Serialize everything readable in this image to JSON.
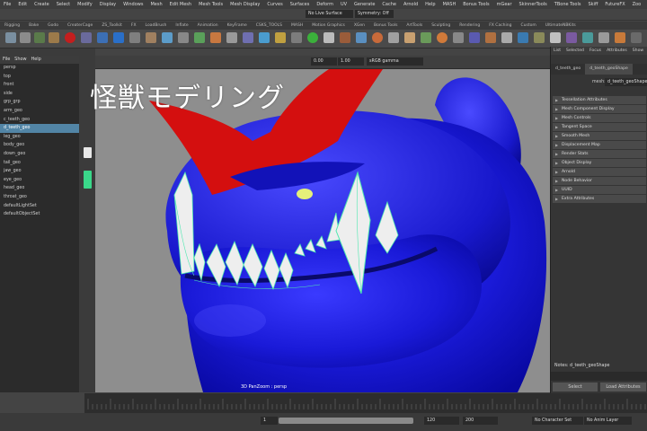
{
  "menubar": [
    "File",
    "Edit",
    "Create",
    "Select",
    "Modify",
    "Display",
    "Windows",
    "Mesh",
    "Edit Mesh",
    "Mesh Tools",
    "Mesh Display",
    "Curves",
    "Surfaces",
    "Deform",
    "UV",
    "Generate",
    "Cache",
    "Arnold",
    "Help",
    "MASH",
    "Bonus Tools",
    "mGear",
    "SkinnerTools",
    "TBone Tools",
    "Skiff",
    "FutureFX",
    "Zoo",
    "Tools",
    "Java Transfer",
    "Y-Fay",
    "Aimodel"
  ],
  "statusline": {
    "no_live_surface": "No Live Surface",
    "symmetry": "Symmetry: Off"
  },
  "shelf_tabs": [
    "Rigging",
    "Bake",
    "Godo",
    "CreaterCage",
    "ZS_Toolkit",
    "FX",
    "LoadBrush",
    "Inflate",
    "Animation",
    "KeyFrame",
    "CSKS_TOOLS",
    "MASH",
    "Motion Graphics",
    "XGen",
    "Bonus Tools",
    "ArtTools",
    "Sculpting",
    "Rendering",
    "FX Caching",
    "Custom",
    "UltimateNBKits"
  ],
  "outliner": {
    "header": [
      "File",
      "Show",
      "Help"
    ],
    "items": [
      "persp",
      "top",
      "front",
      "side",
      "grp_grp",
      "arm_geo",
      "c_teeth_geo",
      "d_teeth_geo",
      "leg_geo",
      "body_geo",
      "down_geo",
      "tail_geo",
      "jaw_geo",
      "eye_geo",
      "head_geo",
      "throat_geo",
      "defaultLightSet",
      "defaultObjectSet"
    ],
    "selected_index": 7
  },
  "viewport": {
    "title_overlay": "怪獣モデリング",
    "camera_label": "3D PanZoom : persp",
    "field_value": "0.00",
    "field2_value": "1.00",
    "colorspace": "sRGB gamma"
  },
  "attribute_editor": {
    "tabs": [
      "List",
      "Selected",
      "Focus",
      "Attributes",
      "Show",
      "Help"
    ],
    "node_tabs": [
      "d_teeth_geo",
      "d_teeth_geoShape"
    ],
    "mesh_label": "mesh:",
    "mesh_value": "d_teeth_geoShape",
    "sections": [
      "Tessellation Attributes",
      "Mesh Component Display",
      "Mesh Controls",
      "Tangent Space",
      "Smooth Mesh",
      "Displacement Map",
      "Render Stats",
      "Object Display",
      "Arnold",
      "Node Behavior",
      "UUID",
      "Extra Attributes"
    ],
    "notes_label": "Notes:  d_teeth_geoShape",
    "buttons": [
      "Select",
      "Load Attributes"
    ]
  },
  "range": {
    "start": "1",
    "end": "120",
    "range_start": "120",
    "range_end": "200",
    "character_set": "No Character Set",
    "anim_layer": "No Anim Layer"
  },
  "colors": {
    "monster_blue": "#1a1adf",
    "horn_red": "#d01010",
    "teeth_white": "#eeeeee",
    "select_green": "#4fe8b0",
    "selection_blue": "#5285a6"
  }
}
